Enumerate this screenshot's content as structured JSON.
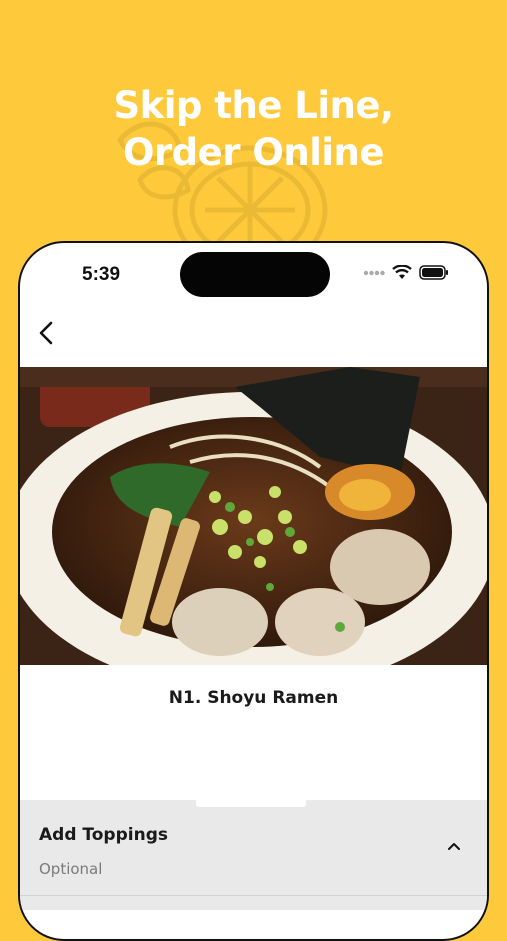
{
  "headline": {
    "line1": "Skip the Line,",
    "line2": "Order Online"
  },
  "status_bar": {
    "time": "5:39"
  },
  "nav": {
    "back_icon": "chevron-left-icon"
  },
  "item": {
    "name": "N1. Shoyu Ramen",
    "image": "ramen-bowl-photo"
  },
  "toppings": {
    "title": "Add Toppings",
    "subtitle": "Optional",
    "toggle_icon": "chevron-up-icon"
  },
  "colors": {
    "background": "#FFC93C",
    "headline_text": "#FFFFFF",
    "section_bg": "#E9E9E9"
  }
}
